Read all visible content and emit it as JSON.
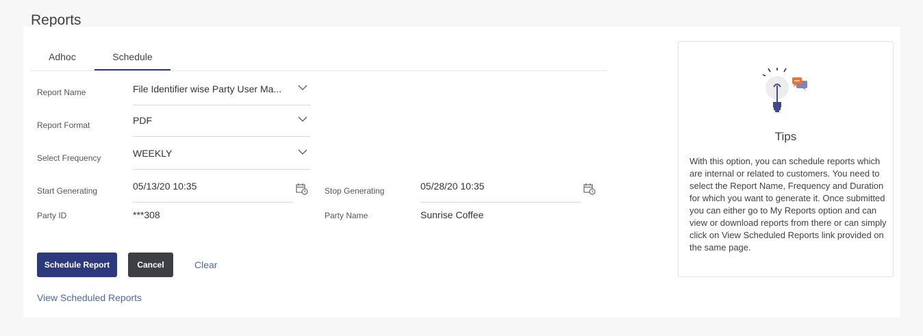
{
  "page": {
    "title": "Reports"
  },
  "tabs": [
    {
      "label": "Adhoc",
      "active": false
    },
    {
      "label": "Schedule",
      "active": true
    }
  ],
  "form": {
    "report_name": {
      "label": "Report Name",
      "value": "File Identifier wise Party User Ma..."
    },
    "report_format": {
      "label": "Report Format",
      "value": "PDF"
    },
    "select_frequency": {
      "label": "Select Frequency",
      "value": "WEEKLY"
    },
    "start_generating": {
      "label": "Start Generating",
      "value": "05/13/20 10:35"
    },
    "stop_generating": {
      "label": "Stop Generating",
      "value": "05/28/20 10:35"
    },
    "party_id": {
      "label": "Party ID",
      "value": "***308"
    },
    "party_name": {
      "label": "Party Name",
      "value": "Sunrise Coffee"
    }
  },
  "actions": {
    "schedule_report": "Schedule Report",
    "cancel": "Cancel",
    "clear": "Clear",
    "view_scheduled_reports": "View Scheduled Reports"
  },
  "tips": {
    "title": "Tips",
    "text": "With this option, you can schedule reports which are internal or related to customers. You need to select the Report Name, Frequency and Duration for which you want to generate it. Once submitted you can either go to My Reports option and can view or download reports from there or can simply click on View Scheduled Reports link provided on the same page."
  },
  "colors": {
    "primary": "#2c3a7d",
    "secondary": "#3e3f44",
    "link": "#4b6a9c",
    "tips_accent": "#e8743b"
  },
  "icons": {
    "dropdown": "chevron-down-icon",
    "calendar": "calendar-clock-icon",
    "tips": "lightbulb-chat-icon"
  }
}
